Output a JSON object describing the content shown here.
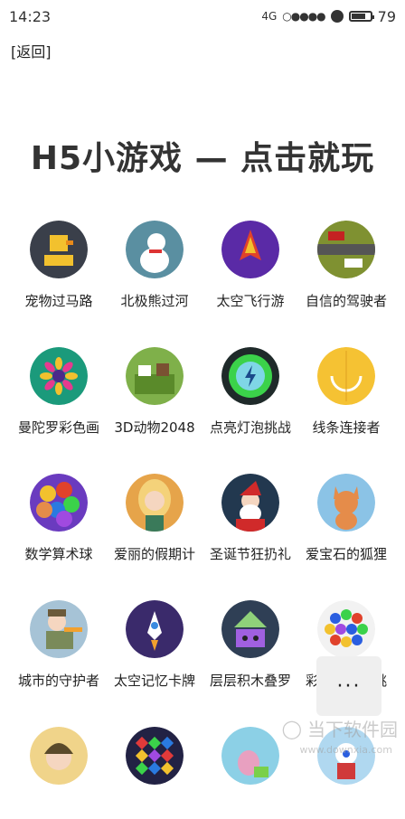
{
  "status": {
    "time": "14:23",
    "network": "4G",
    "signal": "○●●●●",
    "battery": "79",
    "battery_level": 0.79
  },
  "back_label": "[返回]",
  "title": "H5小游戏 — 点击就玩",
  "games": [
    {
      "name": "宠物过马路",
      "icon": "duck-crossing-icon",
      "bg": "#3a3f4a",
      "fg": "#f2c12e"
    },
    {
      "name": "北极熊过河",
      "icon": "polar-bear-icon",
      "bg": "#5a8fa1",
      "fg": "#ffffff"
    },
    {
      "name": "太空飞行游",
      "icon": "rocket-ship-icon",
      "bg": "#5a2aa6",
      "fg": "#e0422b"
    },
    {
      "name": "自信的驾驶者",
      "icon": "car-road-icon",
      "bg": "#7f9131",
      "fg": "#c42222"
    },
    {
      "name": "曼陀罗彩色画",
      "icon": "mandala-icon",
      "bg": "#1b9a7b",
      "fg": "#e53a8f"
    },
    {
      "name": "3D动物2048",
      "icon": "block-animals-icon",
      "bg": "#7fb04a",
      "fg": "#7a5132"
    },
    {
      "name": "点亮灯泡挑战",
      "icon": "lightning-circle-icon",
      "bg": "#1f2a2a",
      "fg": "#3bd24a"
    },
    {
      "name": "线条连接者",
      "icon": "line-arc-icon",
      "bg": "#f5c233",
      "fg": "#ffffff"
    },
    {
      "name": "数学算术球",
      "icon": "math-balls-icon",
      "bg": "#6a3bbf",
      "fg": "#f2c12e"
    },
    {
      "name": "爱丽的假期计",
      "icon": "girl-portrait-icon",
      "bg": "#e6a44a",
      "fg": "#f4d27a"
    },
    {
      "name": "圣诞节狂扔礼",
      "icon": "santa-icon",
      "bg": "#22384f",
      "fg": "#d02a2a"
    },
    {
      "name": "爱宝石的狐狸",
      "icon": "fox-icon",
      "bg": "#8bc3e6",
      "fg": "#e58c4a"
    },
    {
      "name": "城市的守护者",
      "icon": "soldier-icon",
      "bg": "#a6c3d6",
      "fg": "#6b5a3a"
    },
    {
      "name": "太空记忆卡牌",
      "icon": "rocket-card-icon",
      "bg": "#3a2a6b",
      "fg": "#ffffff"
    },
    {
      "name": "层层积木叠罗",
      "icon": "stacked-blocks-icon",
      "bg": "#2f3f55",
      "fg": "#8fd17a"
    },
    {
      "name": "彩色泡泡龙挑",
      "icon": "bubble-shooter-icon",
      "bg": "#f2f2f2",
      "fg": "#2a5ee0"
    },
    {
      "name": "",
      "icon": "cartoon-girl-icon",
      "bg": "#f0d48a",
      "fg": "#5a4a2a"
    },
    {
      "name": "",
      "icon": "gems-icon",
      "bg": "#222244",
      "fg": "#e03a3a"
    },
    {
      "name": "",
      "icon": "pink-animal-icon",
      "bg": "#8cd0e6",
      "fg": "#e8a0c0"
    },
    {
      "name": "",
      "icon": "robot-hero-icon",
      "bg": "#b0d8f0",
      "fg": "#d03a3a"
    }
  ],
  "more_label": "···",
  "watermark": {
    "text": "当下软件园",
    "sub": "www.downxia.com"
  }
}
